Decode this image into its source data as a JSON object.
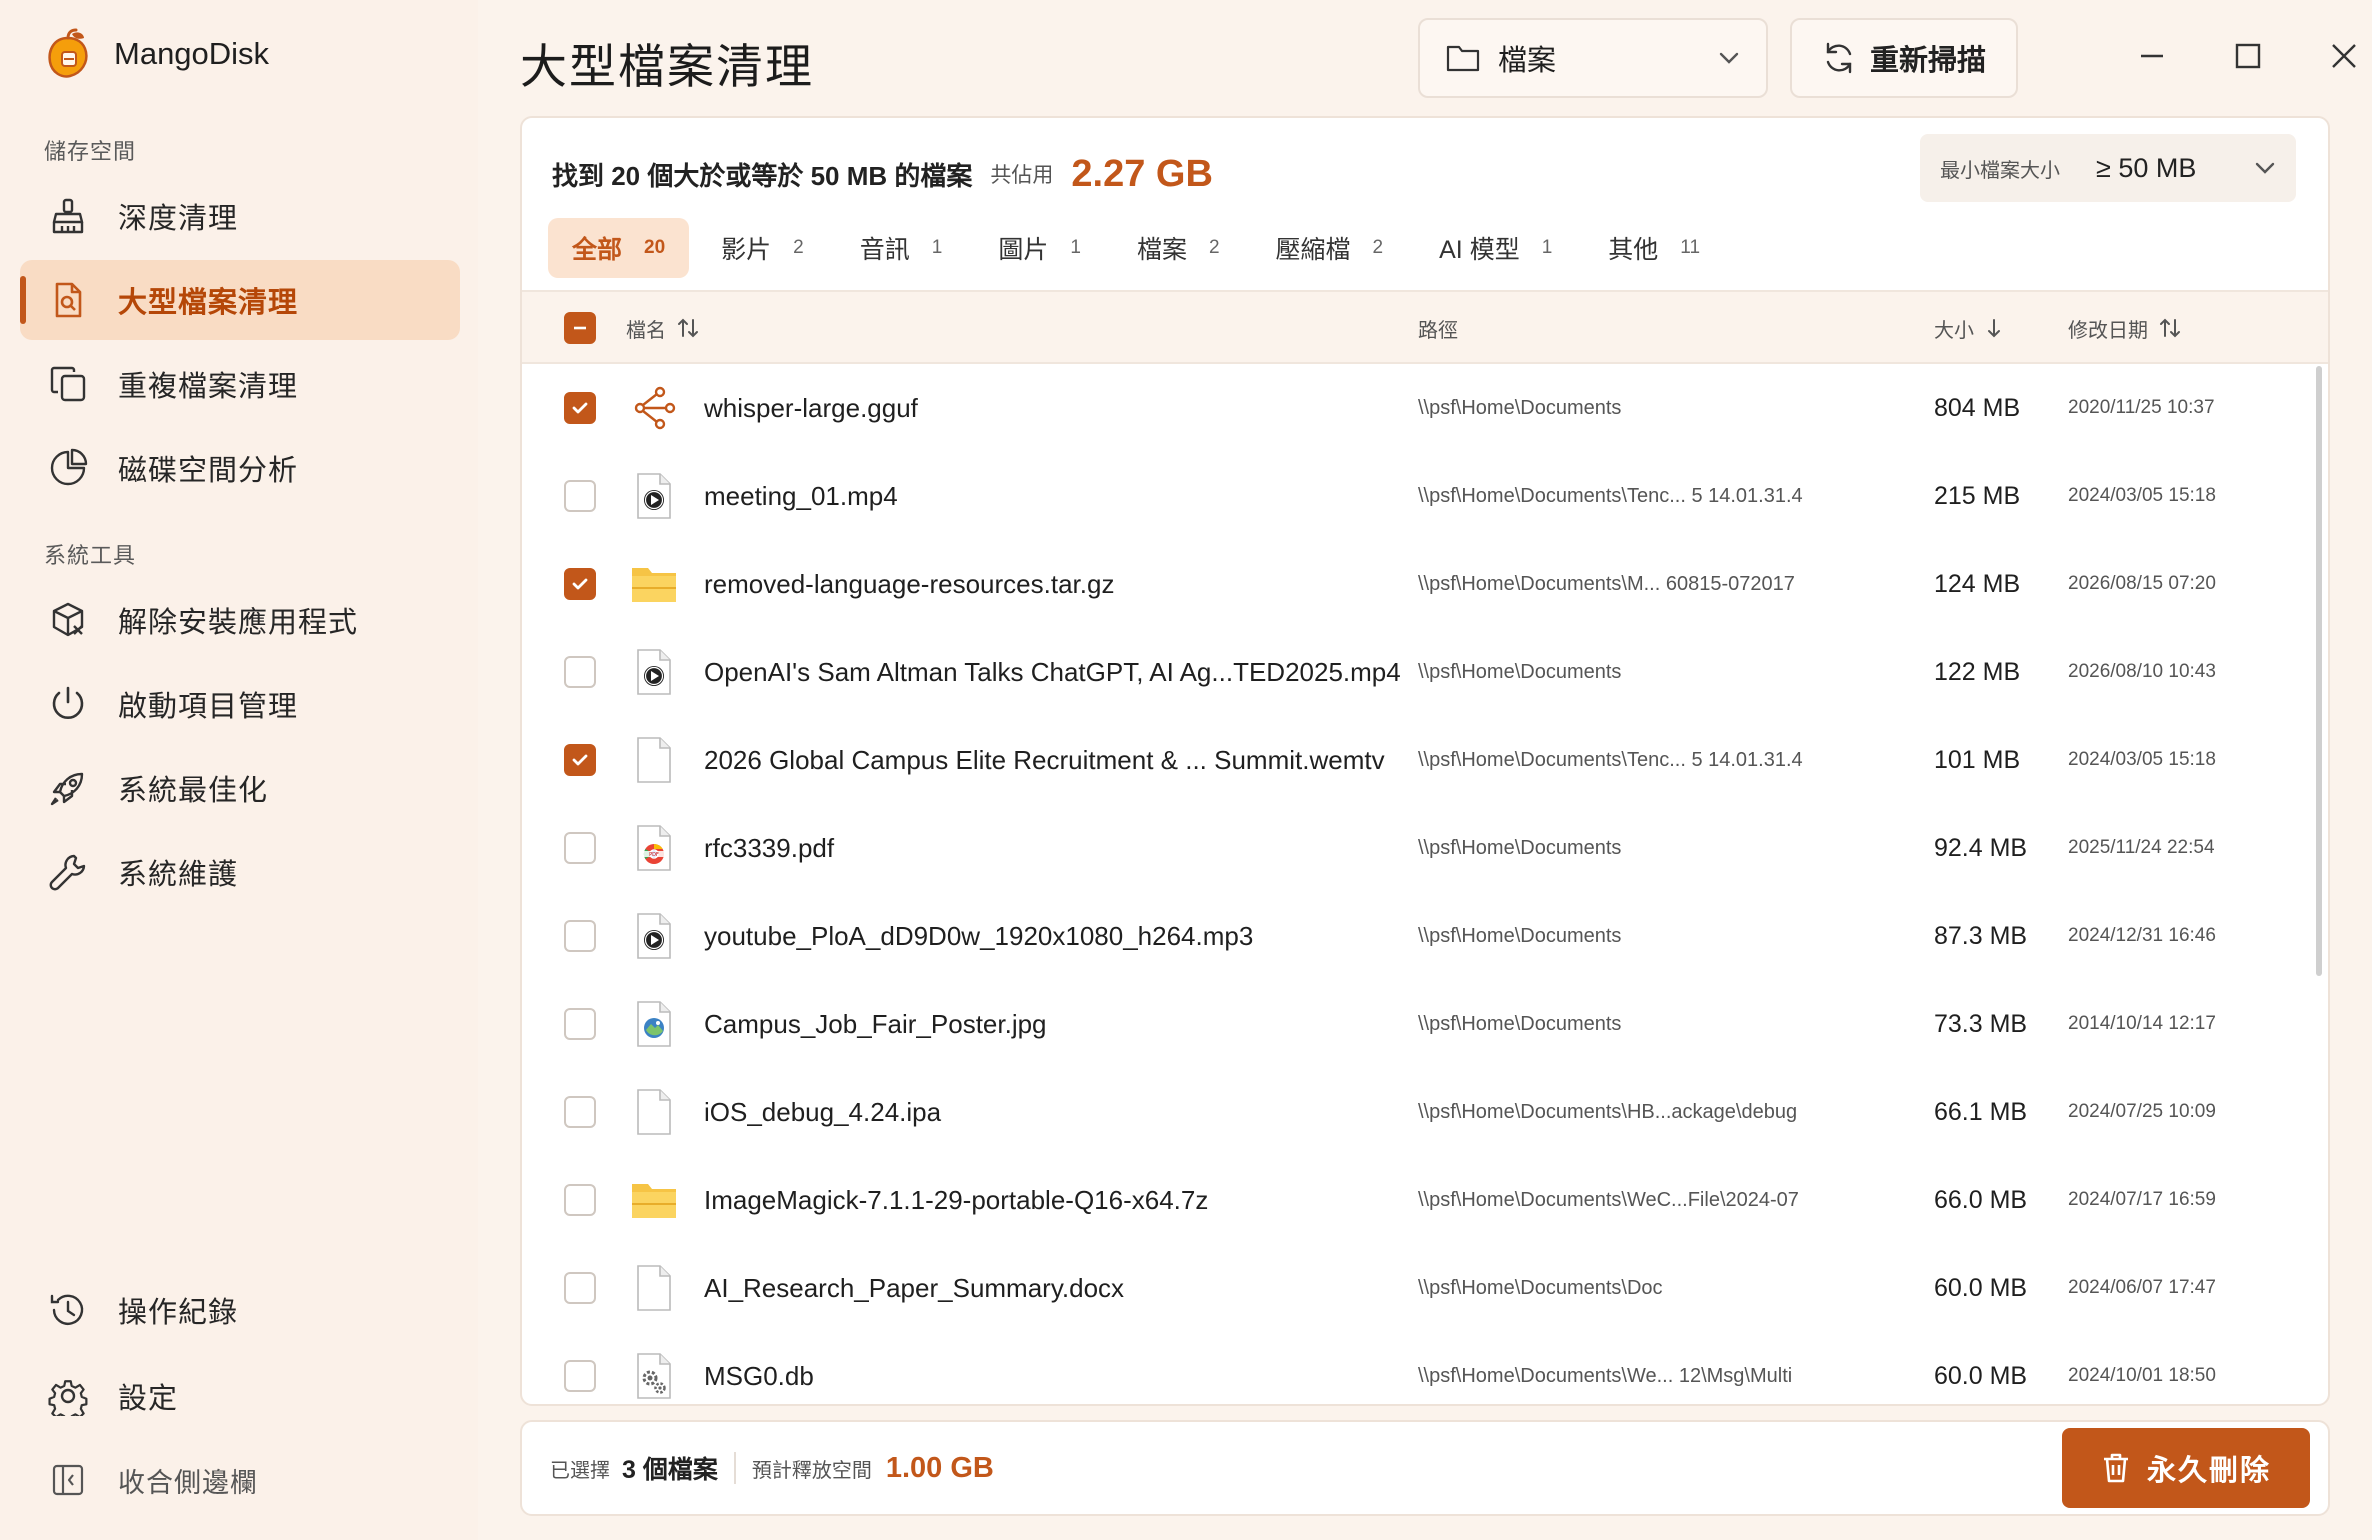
{
  "app": {
    "name": "MangoDisk"
  },
  "sidebar": {
    "storage_title": "儲存空間",
    "storage_items": [
      {
        "label": "深度清理",
        "icon": "broom-icon"
      },
      {
        "label": "大型檔案清理",
        "icon": "file-search-icon",
        "active": true
      },
      {
        "label": "重複檔案清理",
        "icon": "duplicate-icon"
      },
      {
        "label": "磁碟空間分析",
        "icon": "pie-chart-icon"
      }
    ],
    "tools_title": "系統工具",
    "tool_items": [
      {
        "label": "解除安裝應用程式",
        "icon": "package-remove-icon"
      },
      {
        "label": "啟動項目管理",
        "icon": "power-icon"
      },
      {
        "label": "系統最佳化",
        "icon": "rocket-icon"
      },
      {
        "label": "系統維護",
        "icon": "wrench-icon"
      }
    ],
    "bottom_items": [
      {
        "label": "操作紀錄",
        "icon": "history-icon"
      },
      {
        "label": "設定",
        "icon": "gear-icon"
      }
    ],
    "collapse_label": "收合側邊欄"
  },
  "header": {
    "title": "大型檔案清理",
    "type_select": "檔案",
    "rescan_label": "重新掃描"
  },
  "summary": {
    "found_text": "找到 20 個大於或等於 50 MB 的檔案",
    "occupy_label": "共佔用",
    "total_size": "2.27 GB",
    "min_size_label": "最小檔案大小",
    "min_size_value": "≥ 50 MB"
  },
  "tabs": [
    {
      "label": "全部",
      "count": "20",
      "active": true
    },
    {
      "label": "影片",
      "count": "2"
    },
    {
      "label": "音訊",
      "count": "1"
    },
    {
      "label": "圖片",
      "count": "1"
    },
    {
      "label": "檔案",
      "count": "2"
    },
    {
      "label": "壓縮檔",
      "count": "2"
    },
    {
      "label": "AI 模型",
      "count": "1"
    },
    {
      "label": "其他",
      "count": "11"
    }
  ],
  "columns": {
    "name": "檔名",
    "path": "路徑",
    "size": "大小",
    "modified": "修改日期"
  },
  "files": [
    {
      "name": "whisper-large.gguf",
      "path": "\\\\psf\\Home\\Documents",
      "size": "804 MB",
      "date": "2020/11/25 10:37",
      "checked": true,
      "icon": "ai-model-icon"
    },
    {
      "name": "meeting_01.mp4",
      "path": "\\\\psf\\Home\\Documents\\Tenc...  5 14.01.31.4",
      "size": "215 MB",
      "date": "2024/03/05 15:18",
      "checked": false,
      "icon": "video-icon"
    },
    {
      "name": "removed-language-resources.tar.gz",
      "path": "\\\\psf\\Home\\Documents\\M...  60815-072017",
      "size": "124 MB",
      "date": "2026/08/15 07:20",
      "checked": true,
      "icon": "archive-folder-icon"
    },
    {
      "name": "OpenAI's Sam Altman Talks ChatGPT, AI Ag...TED2025.mp4",
      "path": "\\\\psf\\Home\\Documents",
      "size": "122 MB",
      "date": "2026/08/10 10:43",
      "checked": false,
      "icon": "video-icon"
    },
    {
      "name": "2026 Global Campus Elite Recruitment & ... Summit.wemtv",
      "path": "\\\\psf\\Home\\Documents\\Tenc...  5 14.01.31.4",
      "size": "101 MB",
      "date": "2024/03/05 15:18",
      "checked": true,
      "icon": "blank-file-icon"
    },
    {
      "name": "rfc3339.pdf",
      "path": "\\\\psf\\Home\\Documents",
      "size": "92.4 MB",
      "date": "2025/11/24 22:54",
      "checked": false,
      "icon": "pdf-chrome-icon"
    },
    {
      "name": "youtube_PloA_dD9D0w_1920x1080_h264.mp3",
      "path": "\\\\psf\\Home\\Documents",
      "size": "87.3 MB",
      "date": "2024/12/31 16:46",
      "checked": false,
      "icon": "audio-icon"
    },
    {
      "name": "Campus_Job_Fair_Poster.jpg",
      "path": "\\\\psf\\Home\\Documents",
      "size": "73.3 MB",
      "date": "2014/10/14 12:17",
      "checked": false,
      "icon": "image-icon"
    },
    {
      "name": "iOS_debug_4.24.ipa",
      "path": "\\\\psf\\Home\\Documents\\HB...ackage\\debug",
      "size": "66.1 MB",
      "date": "2024/07/25 10:09",
      "checked": false,
      "icon": "blank-file-icon"
    },
    {
      "name": "ImageMagick-7.1.1-29-portable-Q16-x64.7z",
      "path": "\\\\psf\\Home\\Documents\\WeC...File\\2024-07",
      "size": "66.0 MB",
      "date": "2024/07/17 16:59",
      "checked": false,
      "icon": "archive-folder-icon"
    },
    {
      "name": "AI_Research_Paper_Summary.docx",
      "path": "\\\\psf\\Home\\Documents\\Doc",
      "size": "60.0 MB",
      "date": "2024/06/07 17:47",
      "checked": false,
      "icon": "blank-file-icon"
    },
    {
      "name": "MSG0.db",
      "path": "\\\\psf\\Home\\Documents\\We...  12\\Msg\\Multi",
      "size": "60.0 MB",
      "date": "2024/10/01 18:50",
      "checked": false,
      "icon": "database-settings-icon"
    }
  ],
  "footer": {
    "selected_label": "已選擇",
    "selected_count": "3 個檔案",
    "free_label": "預計釋放空間",
    "free_size": "1.00 GB",
    "delete_label": "永久刪除"
  },
  "colors": {
    "accent": "#c2571a",
    "sidebar_bg": "#fbf1e9",
    "active_bg": "#f9dcc4"
  }
}
